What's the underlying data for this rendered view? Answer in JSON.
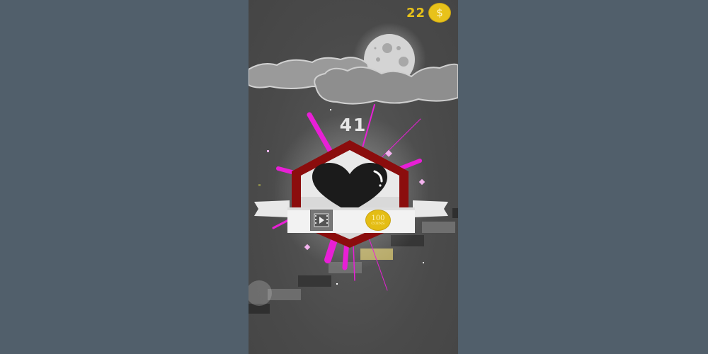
{
  "hud": {
    "coins": "22",
    "coin_symbol": "$"
  },
  "score": "41",
  "reward": {
    "amount": "100",
    "unit": "COINS"
  },
  "icons": {
    "coin": "dollar-coin-icon",
    "video": "film-play-icon",
    "heart": "heart-icon",
    "moon": "moon-icon"
  },
  "colors": {
    "coin_gold": "#e8c21a",
    "badge_red": "#8b0d0d",
    "burst_magenta": "#e81fd6",
    "viewport_bg": "#515f6b"
  }
}
